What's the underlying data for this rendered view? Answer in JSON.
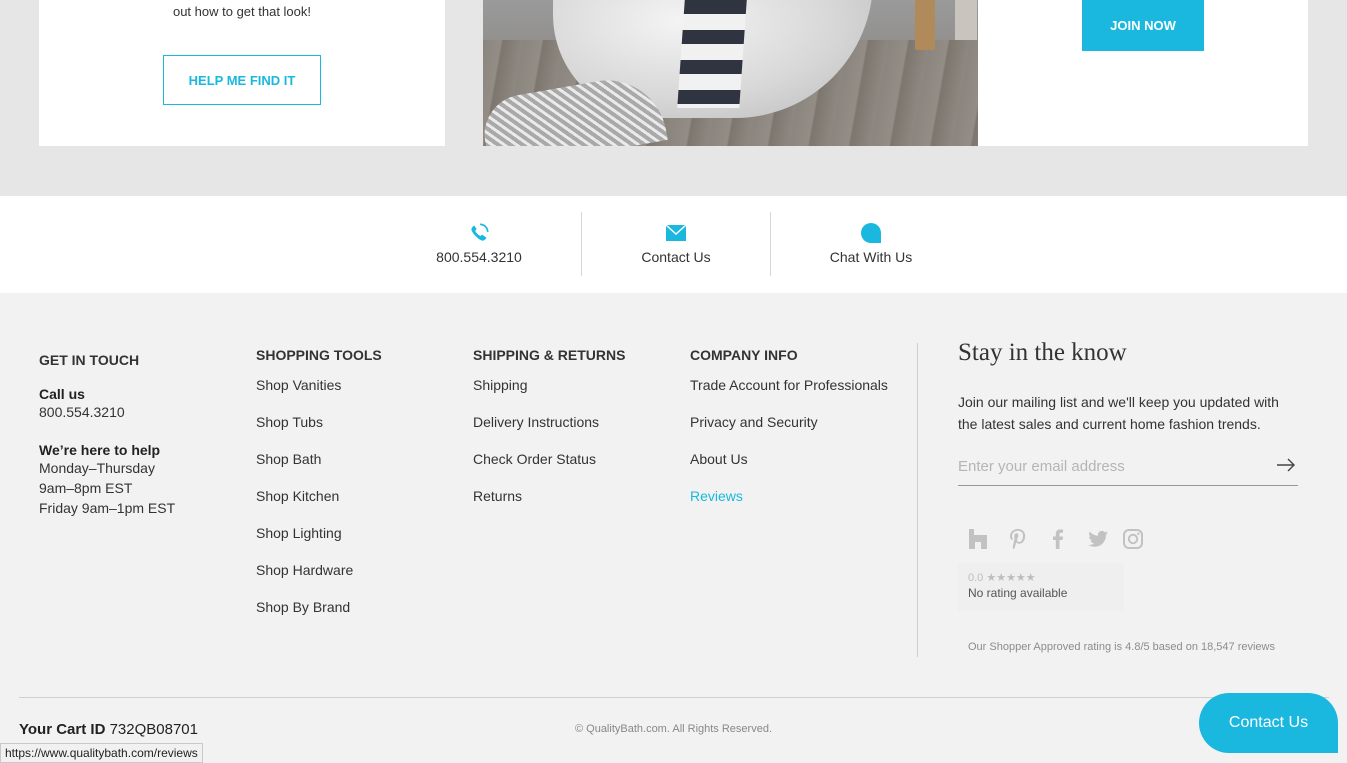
{
  "promo": {
    "left_text": "out how to get that look!",
    "help_button": "HELP ME FIND IT",
    "join_button": "JOIN NOW"
  },
  "contact_strip": {
    "phone": "800.554.3210",
    "contact": "Contact Us",
    "chat": "Chat With Us"
  },
  "footer": {
    "get_in_touch": {
      "heading": "GET IN TOUCH",
      "call_label": "Call us",
      "call_number": "800.554.3210",
      "help_label": "We’re here to help",
      "hours": [
        "Monday–Thursday",
        "9am–8pm EST",
        "Friday 9am–1pm EST"
      ]
    },
    "shopping_tools": {
      "heading": "SHOPPING TOOLS",
      "links": [
        "Shop Vanities",
        "Shop Tubs",
        "Shop Bath",
        "Shop Kitchen",
        "Shop Lighting",
        "Shop Hardware",
        "Shop By Brand"
      ]
    },
    "shipping_returns": {
      "heading": "SHIPPING & RETURNS",
      "links": [
        "Shipping",
        "Delivery Instructions",
        "Check Order Status",
        "Returns"
      ]
    },
    "company_info": {
      "heading": "COMPANY INFO",
      "links": [
        "Trade Account for Professionals",
        "Privacy and Security",
        "About Us",
        "Reviews"
      ]
    },
    "newsletter": {
      "title": "Stay in the know",
      "text": "Join our mailing list and we'll keep you updated with the latest sales and current home fashion trends.",
      "placeholder": "Enter your email address"
    },
    "social_icons": [
      "houzz-icon",
      "pinterest-icon",
      "facebook-icon",
      "twitter-icon",
      "instagram-icon"
    ],
    "rating": {
      "score": "0.0 ★★★★★",
      "none": "No rating available"
    },
    "shopper_approved": "Our Shopper Approved rating is 4.8/5 based on 18,547 reviews",
    "cart_label": "Your Cart ID",
    "cart_id": "732QB08701",
    "copyright": "© QualityBath.com. All Rights Reserved.",
    "contact_fab": "Contact Us"
  },
  "status_url": "https://www.qualitybath.com/reviews",
  "colors": {
    "accent": "#1ab8df",
    "footer_bg": "#f2f2f2",
    "band_bg": "#e6e6e6"
  }
}
